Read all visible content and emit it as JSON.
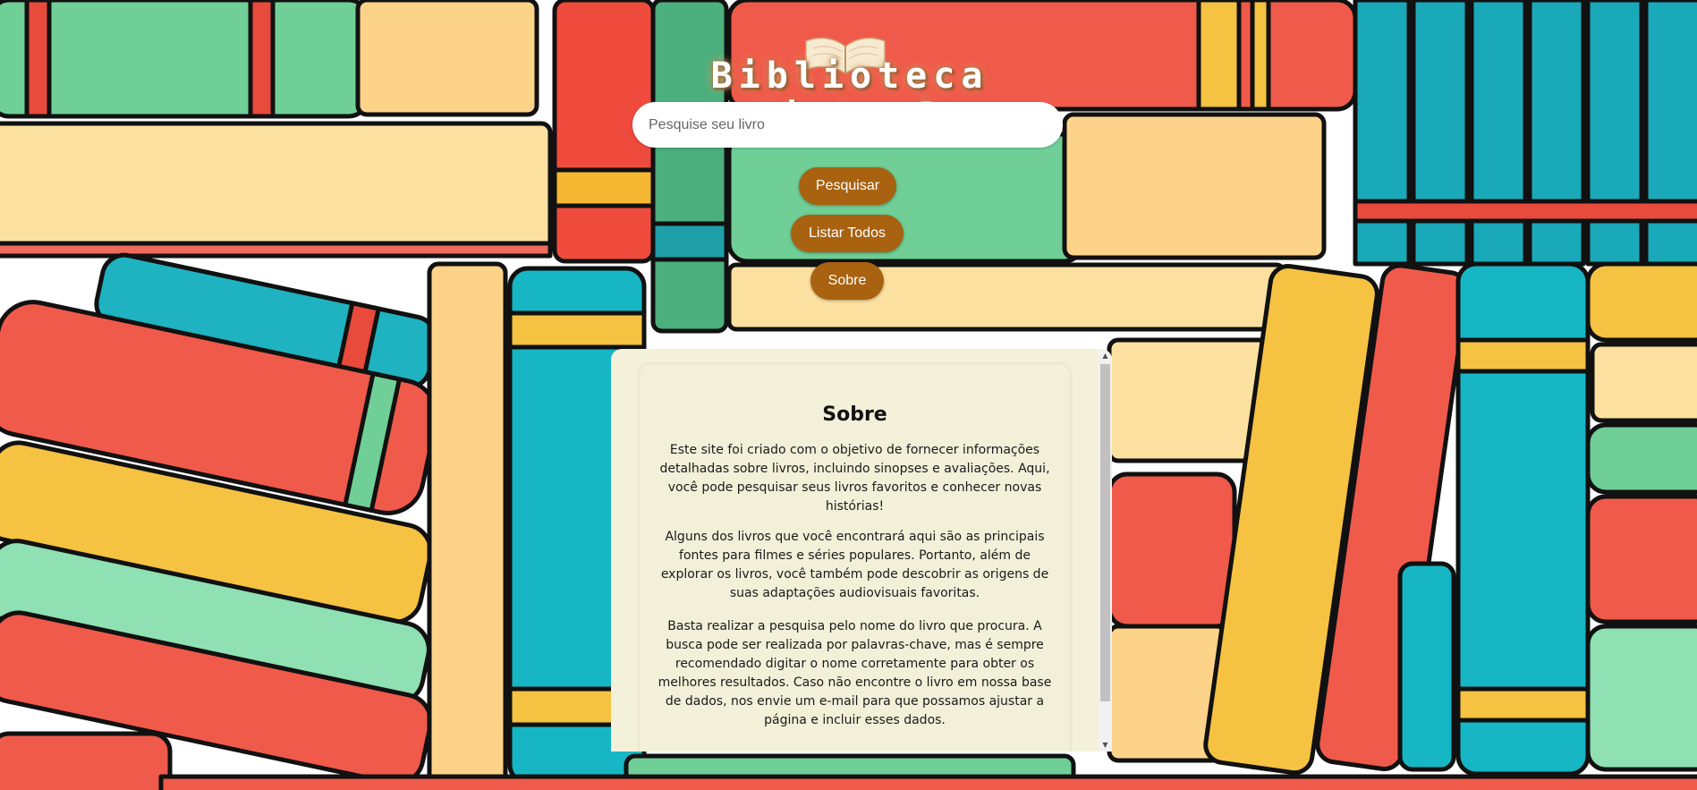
{
  "header": {
    "title": "Biblioteca Virtual",
    "logo_icon": "open-book-icon"
  },
  "search": {
    "placeholder": "Pesquise seu livro",
    "value": ""
  },
  "buttons": {
    "search_label": "Pesquisar",
    "list_all_label": "Listar Todos",
    "about_label": "Sobre"
  },
  "about": {
    "title": "Sobre",
    "paragraph_1": "Este site foi criado com o objetivo de fornecer informações detalhadas sobre livros, incluindo sinopses e avaliações. Aqui, você pode pesquisar seus livros favoritos e conhecer novas histórias!",
    "paragraph_2": "Alguns dos livros que você encontrará aqui são as principais fontes para filmes e séries populares. Portanto, além de explorar os livros, você também pode descobrir as origens de suas adaptações audiovisuais favoritas.",
    "paragraph_3": "Basta realizar a pesquisa pelo nome do livro que procura. A busca pode ser realizada por palavras-chave, mas é sempre recomendado digitar o nome corretamente para obter os melhores resultados. Caso não encontre o livro em nossa base de dados, nos envie um e-mail para que possamos ajustar a página e incluir esses dados."
  },
  "colors": {
    "button_bg": "#a86210",
    "panel_bg": "#f3f1d9",
    "title_glow": "#d8a46a"
  },
  "icons": {
    "scroll_up": "▲",
    "scroll_down": "▼"
  }
}
